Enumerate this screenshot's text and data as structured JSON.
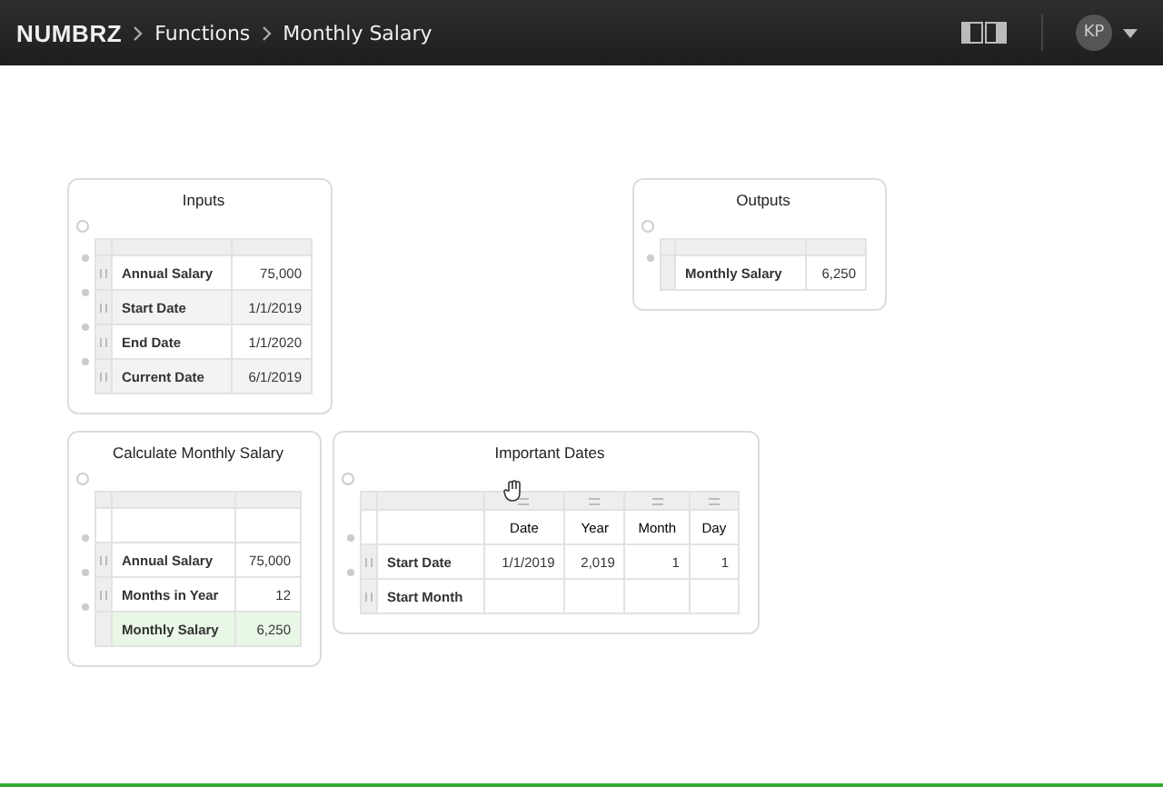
{
  "app": {
    "logo": "NUMBRZ",
    "breadcrumbs": [
      "Functions",
      "Monthly Salary"
    ],
    "user_initials": "KP"
  },
  "cards": [
    {
      "title": "Inputs",
      "rows": [
        {
          "label": "Annual Salary",
          "value": "75,000",
          "kind": "input"
        },
        {
          "label": "Start Date",
          "value": "1/1/2019",
          "kind": "input"
        },
        {
          "label": "End Date",
          "value": "1/1/2020",
          "kind": "input"
        },
        {
          "label": "Current Date",
          "value": "6/1/2019",
          "kind": "input"
        }
      ]
    },
    {
      "title": "Outputs",
      "rows": [
        {
          "label": "Monthly Salary",
          "value": "6,250",
          "kind": "plain"
        }
      ]
    },
    {
      "title": "Calculate Monthly Salary",
      "header_spacer": true,
      "rows": [
        {
          "label": "Annual Salary",
          "value": "75,000",
          "kind": "input"
        },
        {
          "label": "Months in Year",
          "value": "12",
          "kind": "input"
        },
        {
          "label": "Monthly Salary",
          "value": "6,250",
          "kind": "output"
        }
      ]
    },
    {
      "title": "Important Dates",
      "columns": [
        "Date",
        "Year",
        "Month",
        "Day"
      ],
      "rows": [
        {
          "label": "Start Date",
          "values": [
            "1/1/2019",
            "2,019",
            "1",
            "1"
          ],
          "kind": "input"
        },
        {
          "label": "Start Month",
          "kind": "input"
        }
      ]
    }
  ]
}
